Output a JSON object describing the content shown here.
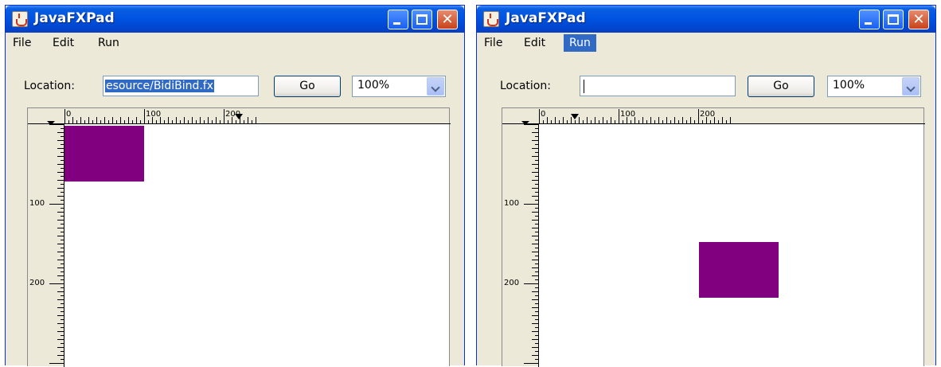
{
  "windows": [
    {
      "title": "JavaFXPad",
      "menu": [
        {
          "key": "file",
          "label": "File"
        },
        {
          "key": "edit",
          "label": "Edit"
        },
        {
          "key": "run",
          "label": "Run"
        }
      ],
      "active_menu": "",
      "location_label": "Location:",
      "location_value": "esource/BidiBind.fx",
      "location_selected": true,
      "go_label": "Go",
      "zoom_value": "100%",
      "ruler_h_labels": [
        "0",
        "100",
        "200"
      ],
      "ruler_v_labels": [
        "100",
        "200"
      ],
      "shape_color": "#800080"
    },
    {
      "title": "JavaFXPad",
      "menu": [
        {
          "key": "file",
          "label": "File"
        },
        {
          "key": "edit",
          "label": "Edit"
        },
        {
          "key": "run",
          "label": "Run"
        }
      ],
      "active_menu": "Run",
      "location_label": "Location:",
      "location_value": "",
      "location_selected": false,
      "go_label": "Go",
      "zoom_value": "100%",
      "ruler_h_labels": [
        "0",
        "100",
        "200"
      ],
      "ruler_v_labels": [
        "100",
        "200"
      ],
      "shape_color": "#800080"
    }
  ],
  "colors": {
    "title_bar": "#0054e3",
    "menu_highlight": "#316ac5",
    "window_bg": "#ece9d8"
  }
}
